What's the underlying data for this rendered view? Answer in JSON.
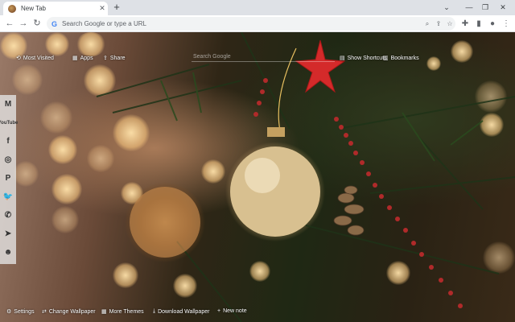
{
  "browser": {
    "tab_title": "New Tab",
    "tab_close": "✕",
    "new_tab": "+",
    "window_controls": [
      "⌄",
      "—",
      "❐",
      "✕"
    ],
    "nav": {
      "back": "←",
      "forward": "→",
      "reload": "↻"
    },
    "omnibox_placeholder": "Search Google or type a URL",
    "omnibox_logo": "G",
    "toolbar_icons": [
      "zoom-icon",
      "share-icon",
      "star-icon",
      "extensions-icon",
      "sidepanel-icon",
      "profile-icon",
      "menu-icon"
    ]
  },
  "page": {
    "top_left": [
      {
        "icon": "⟲",
        "label": "Most Visited"
      },
      {
        "icon": "▦",
        "label": "Apps"
      },
      {
        "icon": "⇪",
        "label": "Share"
      }
    ],
    "search_placeholder": "Search Google",
    "top_right": [
      {
        "icon": "▤",
        "label": "Show Shortcuts"
      },
      {
        "icon": "▥",
        "label": "Bookmarks"
      }
    ],
    "side_rail": [
      {
        "name": "gmail-icon",
        "glyph": "M"
      },
      {
        "name": "youtube-icon",
        "glyph": "YouTube"
      },
      {
        "name": "facebook-icon",
        "glyph": "f"
      },
      {
        "name": "instagram-icon",
        "glyph": "◎"
      },
      {
        "name": "pinterest-icon",
        "glyph": "P"
      },
      {
        "name": "twitter-icon",
        "glyph": "🐦"
      },
      {
        "name": "whatsapp-icon",
        "glyph": "✆"
      },
      {
        "name": "telegram-icon",
        "glyph": "➤"
      },
      {
        "name": "reddit-icon",
        "glyph": "☻"
      }
    ],
    "bottom": [
      {
        "icon": "⚙",
        "label": "Settings"
      },
      {
        "icon": "⇄",
        "label": "Change Wallpaper"
      },
      {
        "icon": "▦",
        "label": "More Themes"
      },
      {
        "icon": "⤓",
        "label": "Download Wallpaper"
      },
      {
        "icon": "+",
        "label": "New note"
      }
    ]
  }
}
